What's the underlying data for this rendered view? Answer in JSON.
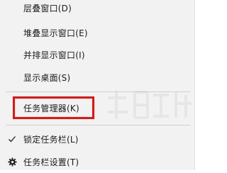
{
  "menu": {
    "items": [
      {
        "label": "层叠窗口(D)"
      },
      {
        "label": "堆叠显示窗口(E)"
      },
      {
        "label": "并排显示窗口(I)"
      },
      {
        "label": "显示桌面(S)"
      },
      {
        "label": "任务管理器(K)"
      },
      {
        "label": "锁定任务栏(L)",
        "checked": true,
        "icon": "checkmark-icon"
      },
      {
        "label": "任务栏设置(T)",
        "icon": "gear-icon"
      }
    ]
  },
  "highlight": {
    "color": "#e8130f",
    "target": "任务管理器(K)"
  },
  "watermark": {
    "icon": "watermark-logo-icon"
  }
}
